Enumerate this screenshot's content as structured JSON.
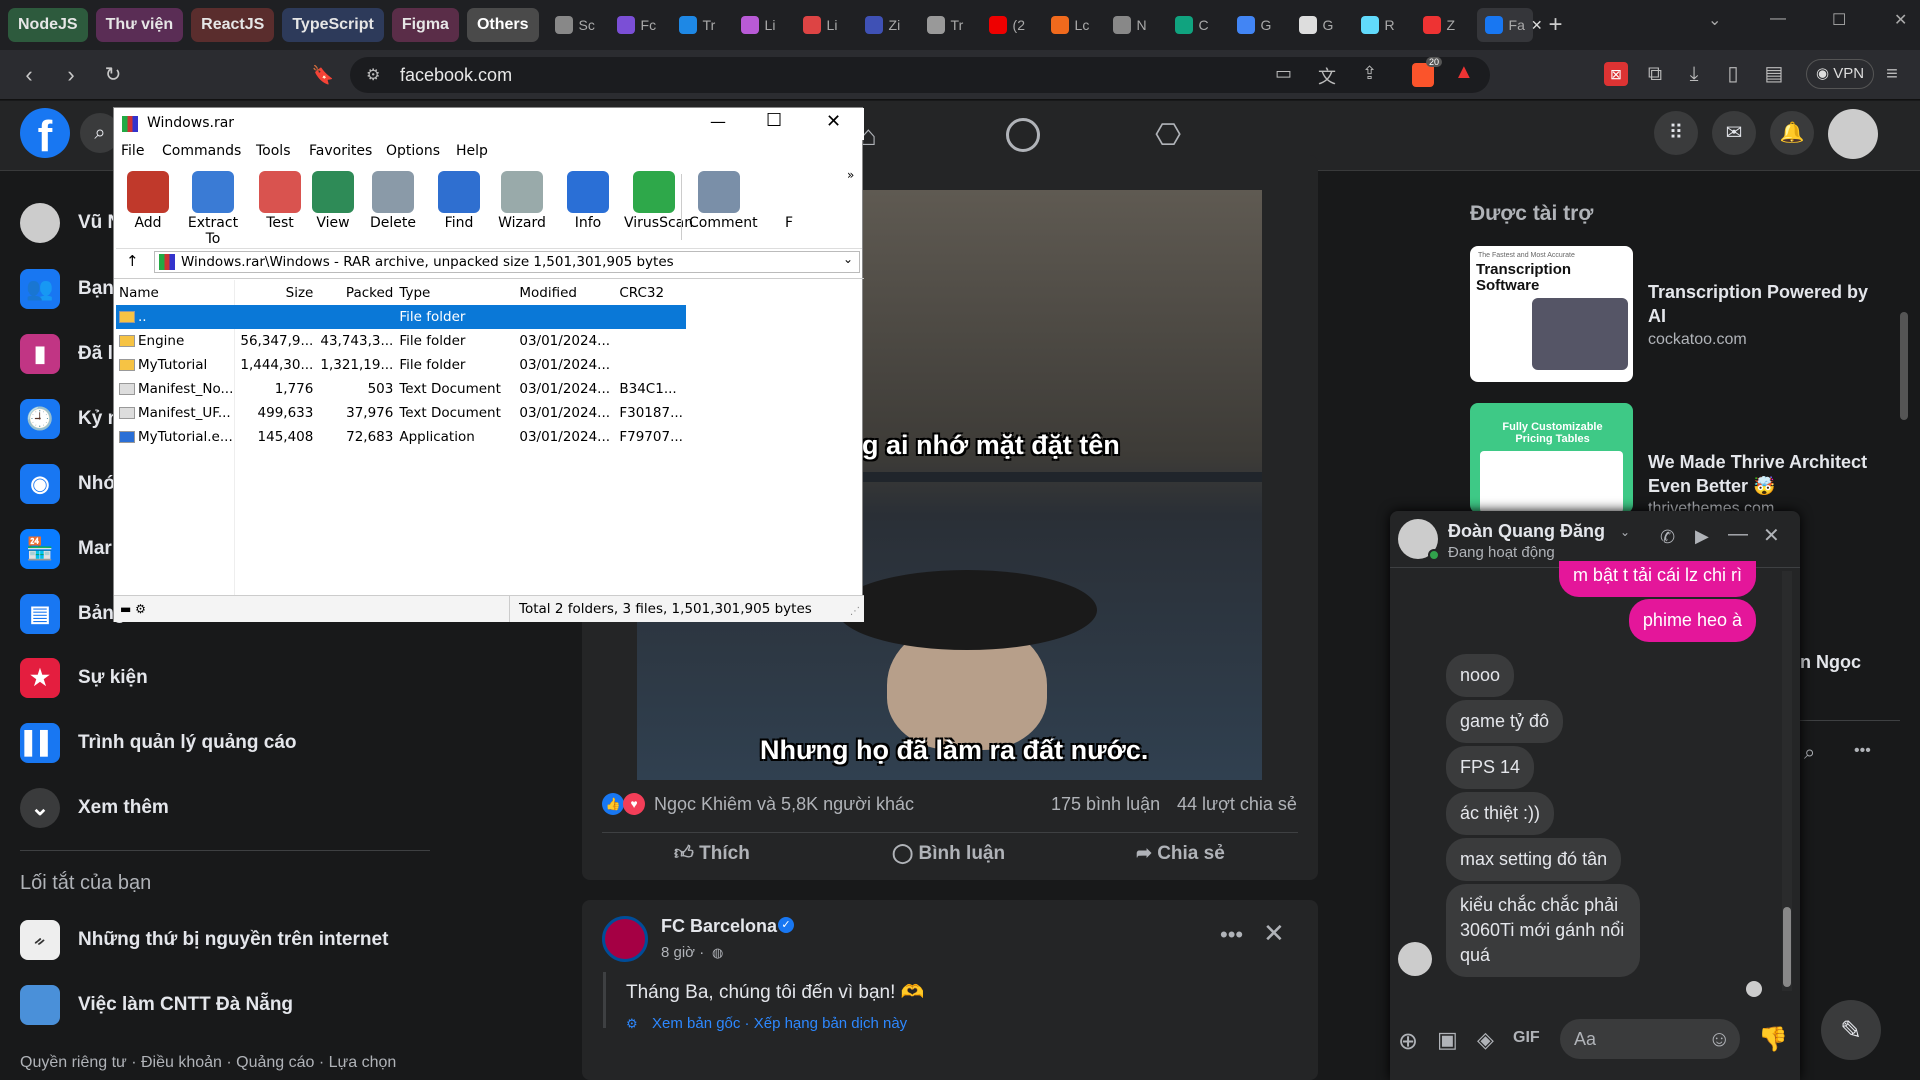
{
  "tabs": {
    "groups": [
      {
        "label": "NodeJS",
        "bg": "#2d5a3d",
        "fg": "#e6e6e6"
      },
      {
        "label": "Thư viện",
        "bg": "#5a2d55",
        "fg": "#e6e6e6"
      },
      {
        "label": "ReactJS",
        "bg": "#5a2d2d",
        "fg": "#e6e6e6"
      },
      {
        "label": "TypeScript",
        "bg": "#2d3a5a",
        "fg": "#e6e6e6"
      },
      {
        "label": "Figma",
        "bg": "#5a2d48",
        "fg": "#e6e6e6"
      },
      {
        "label": "Others",
        "bg": "#4a4a4a",
        "fg": "#ffffff"
      }
    ],
    "items": [
      {
        "label": "Sc",
        "color": "#888"
      },
      {
        "label": "Fc",
        "color": "#7b4fd6"
      },
      {
        "label": "Tr",
        "color": "#1e88e5"
      },
      {
        "label": "Li",
        "color": "#b85ad6"
      },
      {
        "label": "Li",
        "color": "#d44"
      },
      {
        "label": "Zi",
        "color": "#3f51b5"
      },
      {
        "label": "Tr",
        "color": "#999"
      },
      {
        "label": "(2",
        "color": "#e00"
      },
      {
        "label": "Lc",
        "color": "#f06a1d"
      },
      {
        "label": "N",
        "color": "#888"
      },
      {
        "label": "C",
        "color": "#10a37f"
      },
      {
        "label": "G",
        "color": "#4285f4"
      },
      {
        "label": "G",
        "color": "#ddd"
      },
      {
        "label": "R",
        "color": "#61dafb"
      },
      {
        "label": "Z",
        "color": "#e33"
      },
      {
        "label": "Fa",
        "color": "#1877f2"
      }
    ],
    "close_glyph": "✕",
    "new_tab_glyph": "+"
  },
  "address": {
    "url": "facebook.com",
    "vpn_label": "VPN",
    "brave_badge": "20"
  },
  "sidebar": {
    "items": [
      {
        "label": "Vũ N",
        "icon": "avatar-icon"
      },
      {
        "label": "Bạn",
        "icon": "friends-icon"
      },
      {
        "label": "Đã l",
        "icon": "saved-icon"
      },
      {
        "label": "Kỷ n",
        "icon": "memories-icon"
      },
      {
        "label": "Nhó",
        "icon": "groups-icon"
      },
      {
        "label": "Mar",
        "icon": "marketplace-icon"
      },
      {
        "label": "Bảng",
        "icon": "feeds-icon"
      },
      {
        "label": "Sự kiện",
        "icon": "events-icon"
      },
      {
        "label": "Trình quản lý quảng cáo",
        "icon": "ads-manager-icon"
      },
      {
        "label": "Xem thêm",
        "icon": "chevron-down-icon"
      }
    ],
    "shortcuts_title": "Lối tắt của bạn",
    "shortcuts": [
      "Những thứ bị nguyền trên internet",
      "Việc làm CNTT Đà Nẵng"
    ],
    "footer": "Quyền riêng tư · Điều khoản · Quảng cáo · Lựa chọn"
  },
  "post1": {
    "subtitle_top": "g ai nhớ mặt đặt tên",
    "subtitle_bottom": "Nhưng họ đã làm ra đất nước.",
    "reactions": "Ngọc Khiêm và 5,8K người khác",
    "comments": "175 bình luận",
    "shares": "44 lượt chia sẻ",
    "like_label": "Thích",
    "comment_label": "Bình luận",
    "share_label": "Chia sẻ"
  },
  "post2": {
    "page_name": "FC Barcelona",
    "time": "8 giờ ·",
    "text": "Tháng Ba, chúng tôi đến vì bạn! 🫶",
    "translate": "Xem bản gốc · Xếp hạng bản dịch này"
  },
  "sponsored": {
    "title": "Được tài trợ",
    "ads": [
      {
        "thumb_title": "Transcription Software",
        "thumb_top": "The Fastest and Most Accurate",
        "title": "Transcription Powered by AI",
        "domain": "cockatoo.com"
      },
      {
        "thumb_title": "Fully Customizable Pricing Tables",
        "title": "We Made Thrive Architect Even Better 🤯",
        "domain": "thrivethemes.com"
      }
    ],
    "contact_fragment": "n Ngọc"
  },
  "chat": {
    "name": "Đoàn Quang Đăng",
    "status": "Đang hoạt động",
    "outgoing": [
      "m bật t tải cái lz chi rì",
      "phime heo à"
    ],
    "incoming": [
      "nooo",
      "game tỷ đô",
      "FPS 14",
      "ác thiệt :))",
      "max setting đó tân",
      "kiểu chắc chắc phải 3060Ti mới gánh nổi quá"
    ],
    "input_placeholder": "Aa"
  },
  "winrar": {
    "title": "Windows.rar",
    "menu": [
      "File",
      "Commands",
      "Tools",
      "Favorites",
      "Options",
      "Help"
    ],
    "tools": [
      {
        "label": "Add",
        "color": "#c0392b"
      },
      {
        "label": "Extract To",
        "color": "#3a7bd5"
      },
      {
        "label": "Test",
        "color": "#d9534f"
      },
      {
        "label": "View",
        "color": "#2e8b57"
      },
      {
        "label": "Delete",
        "color": "#8a9aa8"
      },
      {
        "label": "Find",
        "color": "#2f6fd0"
      },
      {
        "label": "Wizard",
        "color": "#9aa"
      },
      {
        "label": "Info",
        "color": "#2a6fd6"
      },
      {
        "label": "VirusScan",
        "color": "#2ea84a"
      },
      {
        "label": "Comment",
        "color": "#7a8fa8"
      },
      {
        "label": "F",
        "color": "#fff"
      }
    ],
    "path": "Windows.rar\\Windows - RAR archive, unpacked size 1,501,301,905 bytes",
    "columns": [
      "Name",
      "Size",
      "Packed",
      "Type",
      "Modified",
      "CRC32"
    ],
    "rows": [
      [
        "..",
        "",
        "",
        "File folder",
        "",
        ""
      ],
      [
        "Engine",
        "56,347,9...",
        "43,743,3...",
        "File folder",
        "03/01/2024...",
        ""
      ],
      [
        "MyTutorial",
        "1,444,30...",
        "1,321,19...",
        "File folder",
        "03/01/2024...",
        ""
      ],
      [
        "Manifest_No...",
        "1,776",
        "503",
        "Text Document",
        "03/01/2024...",
        "B34C1..."
      ],
      [
        "Manifest_UF...",
        "499,633",
        "37,976",
        "Text Document",
        "03/01/2024...",
        "F30187..."
      ],
      [
        "MyTutorial.e...",
        "145,408",
        "72,683",
        "Application",
        "03/01/2024...",
        "F79707..."
      ]
    ],
    "status": "Total 2 folders, 3 files, 1,501,301,905 bytes"
  }
}
